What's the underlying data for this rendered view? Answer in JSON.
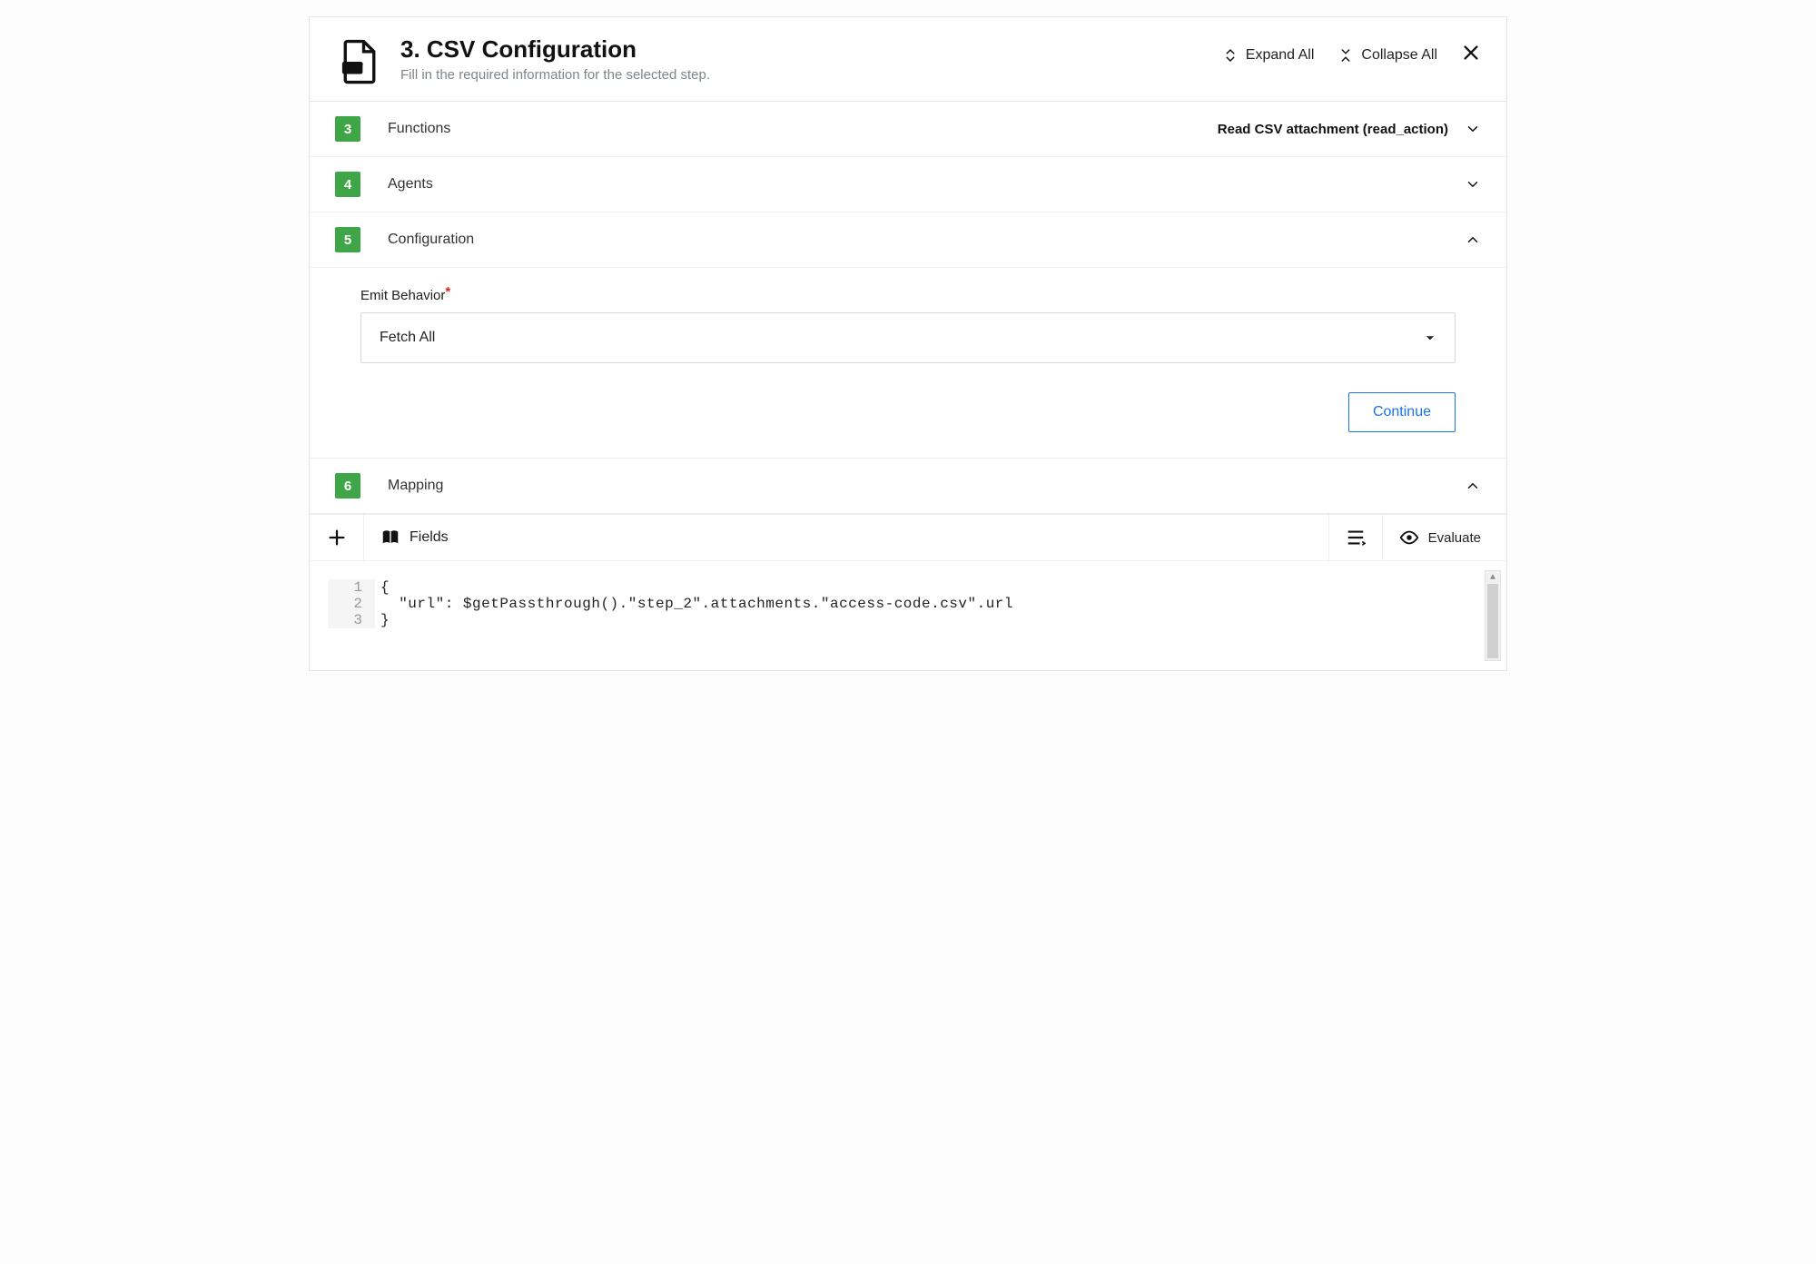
{
  "header": {
    "title": "3. CSV Configuration",
    "subtitle": "Fill in the required information for the selected step.",
    "expand_label": "Expand All",
    "collapse_label": "Collapse All"
  },
  "sections": {
    "functions": {
      "num": "3",
      "label": "Functions",
      "summary": "Read CSV attachment (read_action)"
    },
    "agents": {
      "num": "4",
      "label": "Agents"
    },
    "configuration": {
      "num": "5",
      "label": "Configuration",
      "emit_label": "Emit Behavior",
      "emit_value": "Fetch All",
      "continue_label": "Continue"
    },
    "mapping": {
      "num": "6",
      "label": "Mapping",
      "fields_label": "Fields",
      "evaluate_label": "Evaluate",
      "code_lines": {
        "l1_num": "1",
        "l1": "{",
        "l2_num": "2",
        "l2": "  \"url\": $getPassthrough().\"step_2\".attachments.\"access-code.csv\".url",
        "l3_num": "3",
        "l3": "}"
      }
    }
  }
}
